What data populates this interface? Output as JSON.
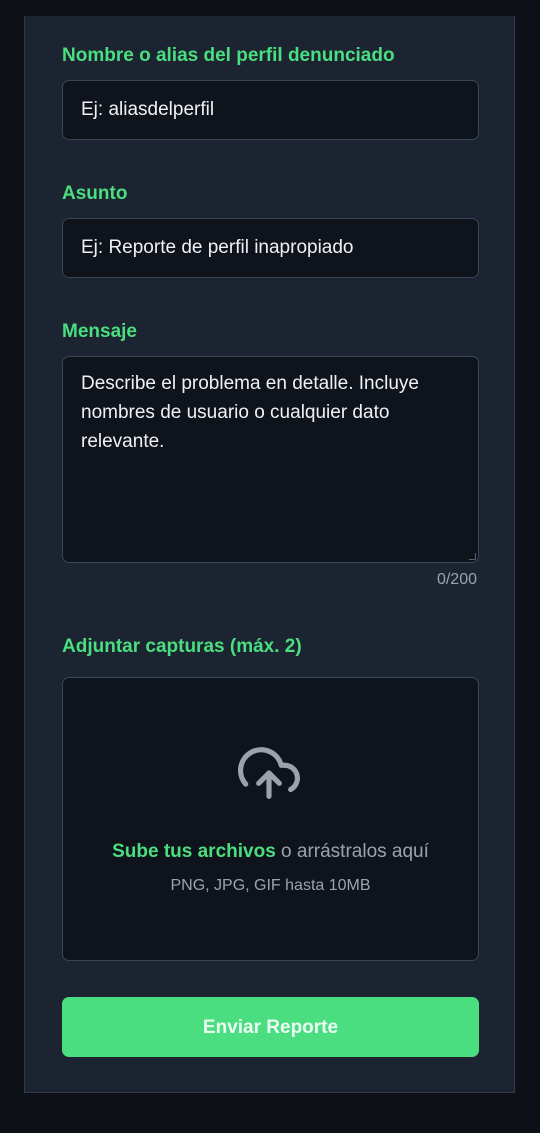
{
  "form": {
    "profile_field": {
      "label": "Nombre o alias del perfil denunciado",
      "placeholder": "Ej: aliasdelperfil"
    },
    "subject_field": {
      "label": "Asunto",
      "placeholder": "Ej: Reporte de perfil inapropiado"
    },
    "message_field": {
      "label": "Mensaje",
      "placeholder": "Describe el problema en detalle. Incluye nombres de usuario o cualquier dato relevante.",
      "counter": "0/200"
    },
    "attachments": {
      "label": "Adjuntar capturas (máx. 2)",
      "upload_link": "Sube tus archivos",
      "drag_text": " o arrástralos aquí",
      "hint": "PNG, JPG, GIF hasta 10MB",
      "icon": "cloud-upload-icon"
    },
    "submit_label": "Enviar Reporte"
  },
  "colors": {
    "accent": "#4ade80",
    "page_background": "#0d1117",
    "card_background": "#1b2430",
    "input_background": "#0f141c"
  }
}
